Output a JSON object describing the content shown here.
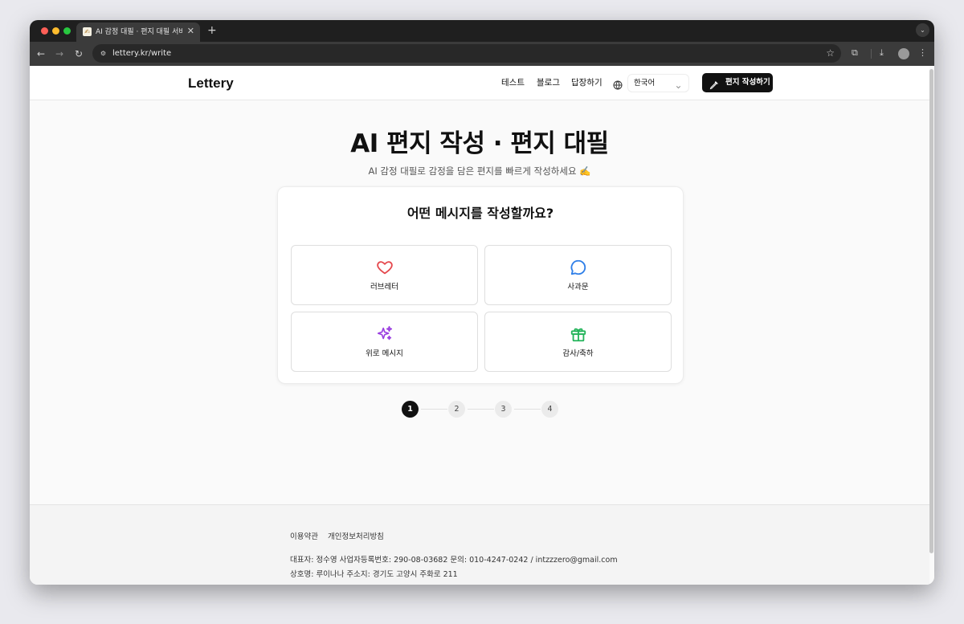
{
  "browser": {
    "tab_title": "AI 감정 대필 · 편지 대필 서비스 - L",
    "url": "lettery.kr/write",
    "favicon": "✍"
  },
  "header": {
    "logo": "Lettery",
    "nav": [
      "테스트",
      "블로그",
      "답장하기"
    ],
    "language": "한국어",
    "write_button": "편지 작성하기"
  },
  "hero": {
    "title": "AI 편지 작성 · 편지 대필",
    "subtitle": "AI 감정 대필로 감정을 담은 편지를 빠르게 작성하세요 ✍️"
  },
  "card": {
    "question": "어떤 메시지를 작성할까요?",
    "options": [
      {
        "label": "러브레터",
        "icon": "heart-icon",
        "color": "#e5484d"
      },
      {
        "label": "사과문",
        "icon": "chat-bubble-icon",
        "color": "#2f7fe8"
      },
      {
        "label": "위로 메시지",
        "icon": "sparkles-icon",
        "color": "#9b40e0"
      },
      {
        "label": "감사/축하",
        "icon": "gift-icon",
        "color": "#23b45a"
      }
    ]
  },
  "steps": {
    "items": [
      "1",
      "2",
      "3",
      "4"
    ],
    "current": 1
  },
  "footer": {
    "links": [
      "이용약관",
      "개인정보처리방침"
    ],
    "info_line1": "대표자: 정수영  사업자등록번호: 290-08-03682  문의: 010-4247-0242 / intzzzero@gmail.com",
    "info_line2": "상호명: 루이나나  주소지: 경기도 고양시 주화로 211"
  }
}
